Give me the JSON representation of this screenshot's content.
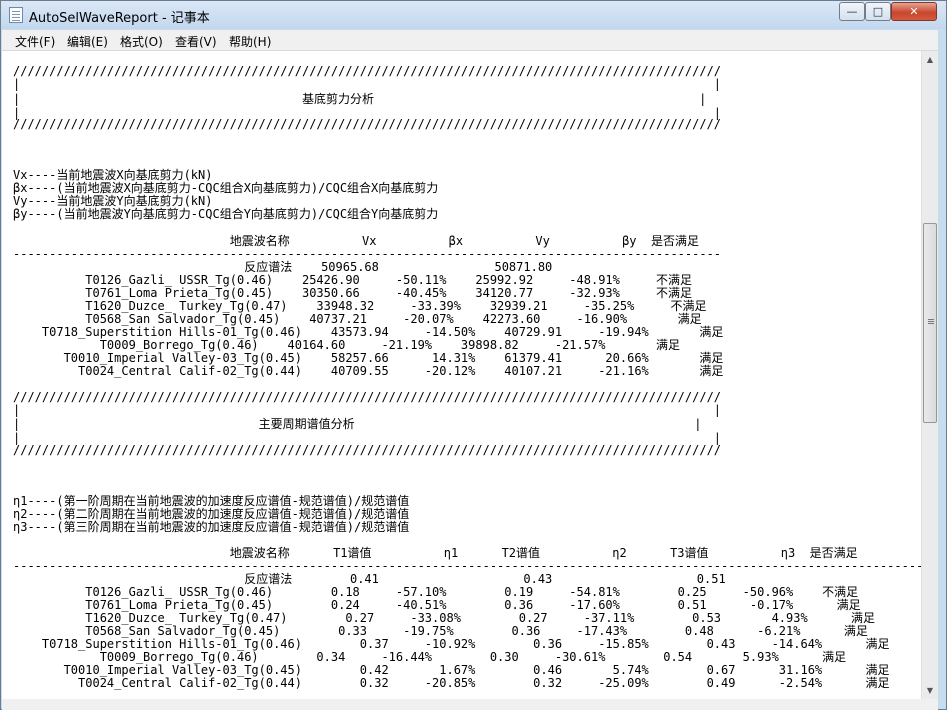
{
  "window": {
    "title": "AutoSelWaveReport - 记事本"
  },
  "caption_buttons": {
    "minimize": "—",
    "maximize": "□",
    "close": "✕"
  },
  "menu": [
    {
      "label": "文件(F)"
    },
    {
      "label": "编辑(E)"
    },
    {
      "label": "格式(O)"
    },
    {
      "label": "查看(V)"
    },
    {
      "label": "帮助(H)"
    }
  ],
  "document": {
    "lines": [
      "//////////////////////////////////////////////////////////////////////////////////////////////////",
      "|                                                                                                |",
      "|                                       基底剪力分析                                             |",
      "|                                                                                                |",
      "//////////////////////////////////////////////////////////////////////////////////////////////////",
      "Vx----当前地震波X向基底剪力(kN)",
      "βx----(当前地震波X向基底剪力-CQC组合X向基底剪力)/CQC组合X向基底剪力",
      "Vy----当前地震波Y向基底剪力(kN)",
      "βy----(当前地震波Y向基底剪力-CQC组合Y向基底剪力)/CQC组合Y向基底剪力",
      "                              地震波名称          Vx          βx          Vy          βy  是否满足",
      "--------------------------------------------------------------------------------------------------",
      "                                反应谱法    50965.68                50871.80",
      "          T0126_Gazli_ USSR_Tg(0.46)    25426.90     -50.11%    25992.92     -48.91%     不满足",
      "          T0761_Loma Prieta_Tg(0.45)    30350.66     -40.45%    34120.77     -32.93%     不满足",
      "          T1620_Duzce_ Turkey_Tg(0.47)    33948.32     -33.39%    32939.21     -35.25%     不满足",
      "          T0568_San Salvador_Tg(0.45)    40737.21     -20.07%    42273.60     -16.90%       满足",
      "    T0718_Superstition Hills-01_Tg(0.46)    43573.94     -14.50%    40729.91     -19.94%       满足",
      "            T0009_Borrego_Tg(0.46)    40164.60     -21.19%    39898.82     -21.57%       满足",
      "       T0010_Imperial Valley-03_Tg(0.45)    58257.66      14.31%    61379.41      20.66%       满足",
      "         T0024_Central Calif-02_Tg(0.44)    40709.55     -20.12%    40107.21     -21.16%       满足",
      "//////////////////////////////////////////////////////////////////////////////////////////////////",
      "|                                                                                                |",
      "|                                 主要周期谱值分析                                               |",
      "|                                                                                                |",
      "//////////////////////////////////////////////////////////////////////////////////////////////////",
      "η1----(第一阶周期在当前地震波的加速度反应谱值-规范谱值)/规范谱值",
      "η2----(第二阶周期在当前地震波的加速度反应谱值-规范谱值)/规范谱值",
      "η3----(第三阶周期在当前地震波的加速度反应谱值-规范谱值)/规范谱值",
      "                              地震波名称      T1谱值          η1      T2谱值          η2      T3谱值          η3  是否满足",
      "--------------------------------------------------------------------------------------------------------------------------------",
      "                                反应谱法        0.41                    0.43                    0.51",
      "          T0126_Gazli_ USSR_Tg(0.46)        0.18     -57.10%        0.19     -54.81%        0.25     -50.96%    不满足",
      "          T0761_Loma Prieta_Tg(0.45)        0.24     -40.51%        0.36     -17.60%        0.51      -0.17%      满足",
      "          T1620_Duzce_ Turkey_Tg(0.47)        0.27     -33.08%        0.27     -37.11%        0.53       4.93%      满足",
      "          T0568_San Salvador_Tg(0.45)        0.33     -19.75%        0.36     -17.43%        0.48      -6.21%      满足",
      "    T0718_Superstition Hills-01_Tg(0.46)        0.37     -10.92%        0.36     -15.85%        0.43     -14.64%      满足",
      "            T0009_Borrego_Tg(0.46)        0.34     -16.44%        0.30     -30.61%        0.54       5.93%      满足",
      "       T0010_Imperial Valley-03_Tg(0.45)        0.42       1.67%        0.46       5.74%        0.67      31.16%      满足",
      "         T0024_Central Calif-02_Tg(0.44)        0.32     -20.85%        0.32     -25.09%        0.49      -2.54%      满足"
    ]
  }
}
